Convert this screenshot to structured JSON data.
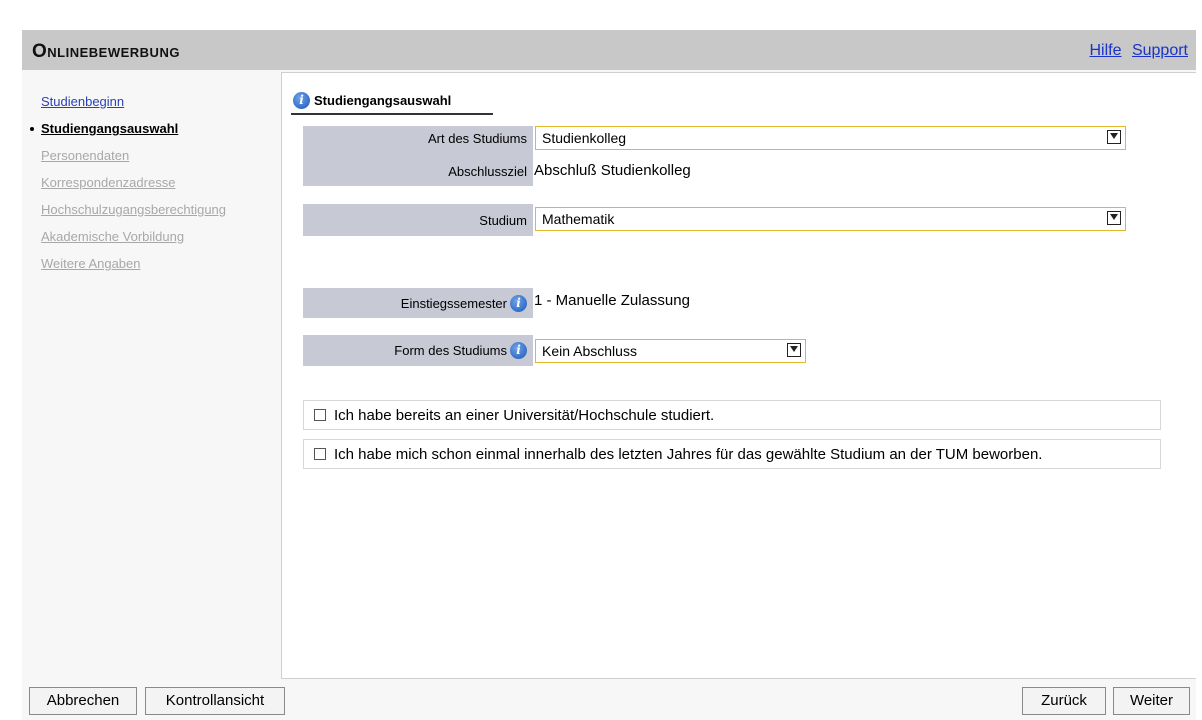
{
  "header": {
    "title": "Onlinebewerbung",
    "links": [
      "Hilfe",
      "Support"
    ]
  },
  "nav": [
    {
      "label": "Studienbeginn",
      "state": "link"
    },
    {
      "label": "Studiengangsauswahl",
      "state": "active"
    },
    {
      "label": "Personendaten",
      "state": "disabled"
    },
    {
      "label": "Korrespondenzadresse",
      "state": "disabled"
    },
    {
      "label": "Hochschulzugangsberechtigung",
      "state": "disabled"
    },
    {
      "label": "Akademische Vorbildung",
      "state": "disabled"
    },
    {
      "label": "Weitere Angaben",
      "state": "disabled"
    }
  ],
  "tab": {
    "label": "Studiengangsauswahl"
  },
  "form": {
    "art_label": "Art des Studiums",
    "art_value": "Studienkolleg",
    "abschluss_label": "Abschlussziel",
    "abschluss_value": "Abschluß Studienkolleg",
    "studium_label": "Studium",
    "studium_value": "Mathematik",
    "einstieg_label": "Einstiegssemester",
    "einstieg_value": "1 - Manuelle Zulassung",
    "form_label": "Form des Studiums",
    "form_value": "Kein Abschluss",
    "checkbox1": "Ich habe bereits an einer Universität/Hochschule studiert.",
    "checkbox2": "Ich habe mich schon einmal innerhalb des letzten Jahres für das gewählte Studium an der TUM beworben."
  },
  "buttons": {
    "abbrechen": "Abbrechen",
    "kontroll": "Kontrollansicht",
    "zurueck": "Zurück",
    "weiter": "Weiter"
  },
  "colors": {
    "header_bg": "#c8c8c8",
    "label_bg": "#c7c9d4",
    "select_border": "#e3b82a",
    "link": "#1a33c6"
  }
}
